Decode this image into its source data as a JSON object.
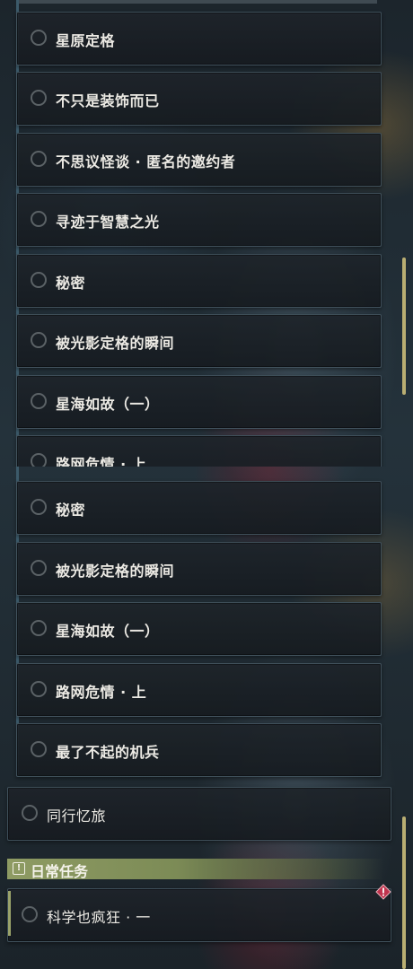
{
  "top_panel": {
    "quests": [
      {
        "label": "星原定格"
      },
      {
        "label": "不只是装饰而已"
      },
      {
        "label": "不思议怪谈 · 匿名的邀约者"
      },
      {
        "label": "寻迹于智慧之光"
      },
      {
        "label": "秘密"
      },
      {
        "label": "被光影定格的瞬间"
      },
      {
        "label": "星海如故（一）"
      },
      {
        "label": "路网危情 · 上"
      }
    ]
  },
  "bottom_panel": {
    "quests": [
      {
        "label": "秘密"
      },
      {
        "label": "被光影定格的瞬间"
      },
      {
        "label": "星海如故（一）"
      },
      {
        "label": "路网危情 · 上"
      },
      {
        "label": "最了不起的机兵"
      }
    ],
    "companion_quest": {
      "label": "同行忆旅"
    },
    "daily_section": {
      "title": "日常任务",
      "icon": "exclamation-box-icon",
      "quests": [
        {
          "label": "科学也疯狂 · 一",
          "badge_icon": "alert-diamond-icon"
        }
      ]
    }
  },
  "colors": {
    "accent_olive": "#8e9b63",
    "scrollbar": "#b9ae72",
    "alert_red": "#c0344e",
    "text": "#eceae4"
  }
}
